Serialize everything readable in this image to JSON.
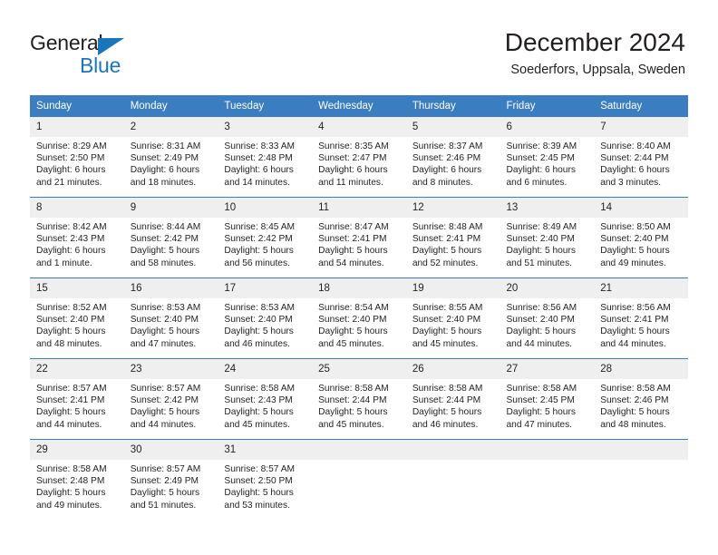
{
  "brand": {
    "name_primary": "General",
    "name_secondary": "Blue",
    "triangle_color": "#1b75bb"
  },
  "header": {
    "title": "December 2024",
    "subtitle": "Soederfors, Uppsala, Sweden"
  },
  "theme": {
    "header_blue": "#3a7dc0",
    "daynum_gray": "#efefef",
    "text": "#231f20"
  },
  "weekday_headers": [
    "Sunday",
    "Monday",
    "Tuesday",
    "Wednesday",
    "Thursday",
    "Friday",
    "Saturday"
  ],
  "weeks": [
    [
      {
        "day": "1",
        "sunrise": "Sunrise: 8:29 AM",
        "sunset": "Sunset: 2:50 PM",
        "daylight": "Daylight: 6 hours and 21 minutes."
      },
      {
        "day": "2",
        "sunrise": "Sunrise: 8:31 AM",
        "sunset": "Sunset: 2:49 PM",
        "daylight": "Daylight: 6 hours and 18 minutes."
      },
      {
        "day": "3",
        "sunrise": "Sunrise: 8:33 AM",
        "sunset": "Sunset: 2:48 PM",
        "daylight": "Daylight: 6 hours and 14 minutes."
      },
      {
        "day": "4",
        "sunrise": "Sunrise: 8:35 AM",
        "sunset": "Sunset: 2:47 PM",
        "daylight": "Daylight: 6 hours and 11 minutes."
      },
      {
        "day": "5",
        "sunrise": "Sunrise: 8:37 AM",
        "sunset": "Sunset: 2:46 PM",
        "daylight": "Daylight: 6 hours and 8 minutes."
      },
      {
        "day": "6",
        "sunrise": "Sunrise: 8:39 AM",
        "sunset": "Sunset: 2:45 PM",
        "daylight": "Daylight: 6 hours and 6 minutes."
      },
      {
        "day": "7",
        "sunrise": "Sunrise: 8:40 AM",
        "sunset": "Sunset: 2:44 PM",
        "daylight": "Daylight: 6 hours and 3 minutes."
      }
    ],
    [
      {
        "day": "8",
        "sunrise": "Sunrise: 8:42 AM",
        "sunset": "Sunset: 2:43 PM",
        "daylight": "Daylight: 6 hours and 1 minute."
      },
      {
        "day": "9",
        "sunrise": "Sunrise: 8:44 AM",
        "sunset": "Sunset: 2:42 PM",
        "daylight": "Daylight: 5 hours and 58 minutes."
      },
      {
        "day": "10",
        "sunrise": "Sunrise: 8:45 AM",
        "sunset": "Sunset: 2:42 PM",
        "daylight": "Daylight: 5 hours and 56 minutes."
      },
      {
        "day": "11",
        "sunrise": "Sunrise: 8:47 AM",
        "sunset": "Sunset: 2:41 PM",
        "daylight": "Daylight: 5 hours and 54 minutes."
      },
      {
        "day": "12",
        "sunrise": "Sunrise: 8:48 AM",
        "sunset": "Sunset: 2:41 PM",
        "daylight": "Daylight: 5 hours and 52 minutes."
      },
      {
        "day": "13",
        "sunrise": "Sunrise: 8:49 AM",
        "sunset": "Sunset: 2:40 PM",
        "daylight": "Daylight: 5 hours and 51 minutes."
      },
      {
        "day": "14",
        "sunrise": "Sunrise: 8:50 AM",
        "sunset": "Sunset: 2:40 PM",
        "daylight": "Daylight: 5 hours and 49 minutes."
      }
    ],
    [
      {
        "day": "15",
        "sunrise": "Sunrise: 8:52 AM",
        "sunset": "Sunset: 2:40 PM",
        "daylight": "Daylight: 5 hours and 48 minutes."
      },
      {
        "day": "16",
        "sunrise": "Sunrise: 8:53 AM",
        "sunset": "Sunset: 2:40 PM",
        "daylight": "Daylight: 5 hours and 47 minutes."
      },
      {
        "day": "17",
        "sunrise": "Sunrise: 8:53 AM",
        "sunset": "Sunset: 2:40 PM",
        "daylight": "Daylight: 5 hours and 46 minutes."
      },
      {
        "day": "18",
        "sunrise": "Sunrise: 8:54 AM",
        "sunset": "Sunset: 2:40 PM",
        "daylight": "Daylight: 5 hours and 45 minutes."
      },
      {
        "day": "19",
        "sunrise": "Sunrise: 8:55 AM",
        "sunset": "Sunset: 2:40 PM",
        "daylight": "Daylight: 5 hours and 45 minutes."
      },
      {
        "day": "20",
        "sunrise": "Sunrise: 8:56 AM",
        "sunset": "Sunset: 2:40 PM",
        "daylight": "Daylight: 5 hours and 44 minutes."
      },
      {
        "day": "21",
        "sunrise": "Sunrise: 8:56 AM",
        "sunset": "Sunset: 2:41 PM",
        "daylight": "Daylight: 5 hours and 44 minutes."
      }
    ],
    [
      {
        "day": "22",
        "sunrise": "Sunrise: 8:57 AM",
        "sunset": "Sunset: 2:41 PM",
        "daylight": "Daylight: 5 hours and 44 minutes."
      },
      {
        "day": "23",
        "sunrise": "Sunrise: 8:57 AM",
        "sunset": "Sunset: 2:42 PM",
        "daylight": "Daylight: 5 hours and 44 minutes."
      },
      {
        "day": "24",
        "sunrise": "Sunrise: 8:58 AM",
        "sunset": "Sunset: 2:43 PM",
        "daylight": "Daylight: 5 hours and 45 minutes."
      },
      {
        "day": "25",
        "sunrise": "Sunrise: 8:58 AM",
        "sunset": "Sunset: 2:44 PM",
        "daylight": "Daylight: 5 hours and 45 minutes."
      },
      {
        "day": "26",
        "sunrise": "Sunrise: 8:58 AM",
        "sunset": "Sunset: 2:44 PM",
        "daylight": "Daylight: 5 hours and 46 minutes."
      },
      {
        "day": "27",
        "sunrise": "Sunrise: 8:58 AM",
        "sunset": "Sunset: 2:45 PM",
        "daylight": "Daylight: 5 hours and 47 minutes."
      },
      {
        "day": "28",
        "sunrise": "Sunrise: 8:58 AM",
        "sunset": "Sunset: 2:46 PM",
        "daylight": "Daylight: 5 hours and 48 minutes."
      }
    ],
    [
      {
        "day": "29",
        "sunrise": "Sunrise: 8:58 AM",
        "sunset": "Sunset: 2:48 PM",
        "daylight": "Daylight: 5 hours and 49 minutes."
      },
      {
        "day": "30",
        "sunrise": "Sunrise: 8:57 AM",
        "sunset": "Sunset: 2:49 PM",
        "daylight": "Daylight: 5 hours and 51 minutes."
      },
      {
        "day": "31",
        "sunrise": "Sunrise: 8:57 AM",
        "sunset": "Sunset: 2:50 PM",
        "daylight": "Daylight: 5 hours and 53 minutes."
      },
      {
        "day": "",
        "sunrise": "",
        "sunset": "",
        "daylight": ""
      },
      {
        "day": "",
        "sunrise": "",
        "sunset": "",
        "daylight": ""
      },
      {
        "day": "",
        "sunrise": "",
        "sunset": "",
        "daylight": ""
      },
      {
        "day": "",
        "sunrise": "",
        "sunset": "",
        "daylight": ""
      }
    ]
  ]
}
